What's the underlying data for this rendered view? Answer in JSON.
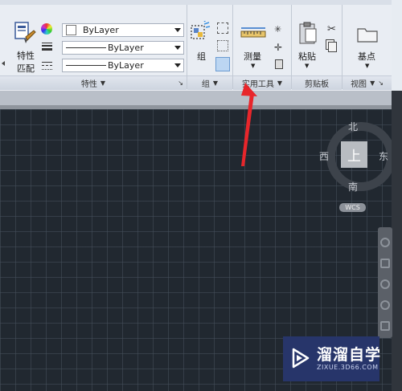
{
  "ribbon": {
    "properties": {
      "match_label_1": "特性",
      "match_label_2": "匹配",
      "color_value": "ByLayer",
      "linetype_value": "ByLayer",
      "lineweight_value": "ByLayer",
      "title": "特性"
    },
    "group": {
      "button_label": "组",
      "title": "组"
    },
    "utilities": {
      "measure_label": "测量",
      "title": "实用工具"
    },
    "clipboard": {
      "paste_label": "粘贴",
      "title": "剪贴板"
    },
    "view": {
      "base_label": "基点",
      "title": "视图"
    }
  },
  "viewcube": {
    "north": "北",
    "south": "南",
    "west": "西",
    "east": "东",
    "top_face": "上",
    "wcs": "WCS"
  },
  "watermark": {
    "name": "溜溜自学",
    "url": "ZIXUE.3D66.COM"
  },
  "colors": {
    "canvas": "#212830",
    "arrow": "#e8262b",
    "ribbon": "#e9edf3",
    "logo": "#27356a"
  }
}
